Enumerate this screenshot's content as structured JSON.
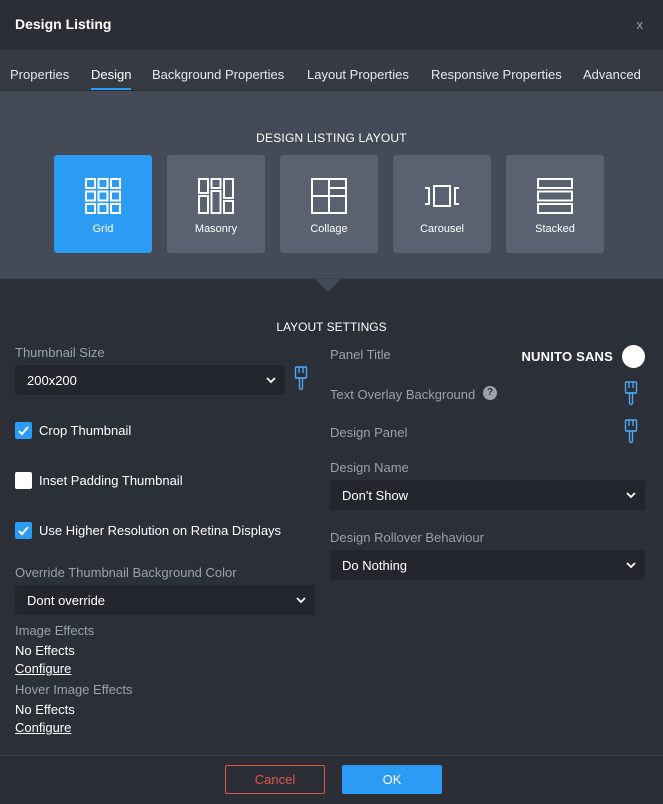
{
  "dialog": {
    "title": "Design Listing",
    "close_label": "x"
  },
  "tabs": [
    {
      "label": "Properties"
    },
    {
      "label": "Design"
    },
    {
      "label": "Background Properties"
    },
    {
      "label": "Layout Properties"
    },
    {
      "label": "Responsive Properties"
    },
    {
      "label": "Advanced"
    }
  ],
  "active_tab": "Design",
  "layout": {
    "heading": "DESIGN LISTING LAYOUT",
    "options": [
      {
        "label": "Grid",
        "icon": "grid-icon"
      },
      {
        "label": "Masonry",
        "icon": "masonry-icon"
      },
      {
        "label": "Collage",
        "icon": "collage-icon"
      },
      {
        "label": "Carousel",
        "icon": "carousel-icon"
      },
      {
        "label": "Stacked",
        "icon": "stacked-icon"
      }
    ],
    "selected": "Grid"
  },
  "settings": {
    "heading": "LAYOUT SETTINGS",
    "left": {
      "thumbnail_size": {
        "label": "Thumbnail Size",
        "value": "200x200"
      },
      "crop_thumbnail": {
        "label": "Crop Thumbnail",
        "checked": true
      },
      "inset_padding": {
        "label": "Inset Padding Thumbnail",
        "checked": false
      },
      "retina": {
        "label": "Use Higher Resolution on Retina Displays",
        "checked": true
      },
      "override_bg": {
        "label": "Override Thumbnail Background Color",
        "value": "Dont override"
      },
      "image_effects": {
        "label": "Image Effects",
        "value": "No Effects",
        "link": "Configure"
      },
      "hover_effects": {
        "label": "Hover Image Effects",
        "value": "No Effects",
        "link": "Configure"
      }
    },
    "right": {
      "panel_title": {
        "label": "Panel Title",
        "font": "NUNITO SANS",
        "color": "#ffffff"
      },
      "text_overlay": {
        "label": "Text Overlay Background",
        "help": "?"
      },
      "design_panel": {
        "label": "Design Panel"
      },
      "design_name": {
        "label": "Design Name",
        "value": "Don't Show"
      },
      "rollover": {
        "label": "Design Rollover Behaviour",
        "value": "Do Nothing"
      }
    }
  },
  "footer": {
    "cancel_label": "Cancel",
    "ok_label": "OK"
  },
  "colors": {
    "accent": "#2b9bf4",
    "cancel": "#d9534f",
    "band": "#454b56",
    "panel": "#2b2f37"
  }
}
